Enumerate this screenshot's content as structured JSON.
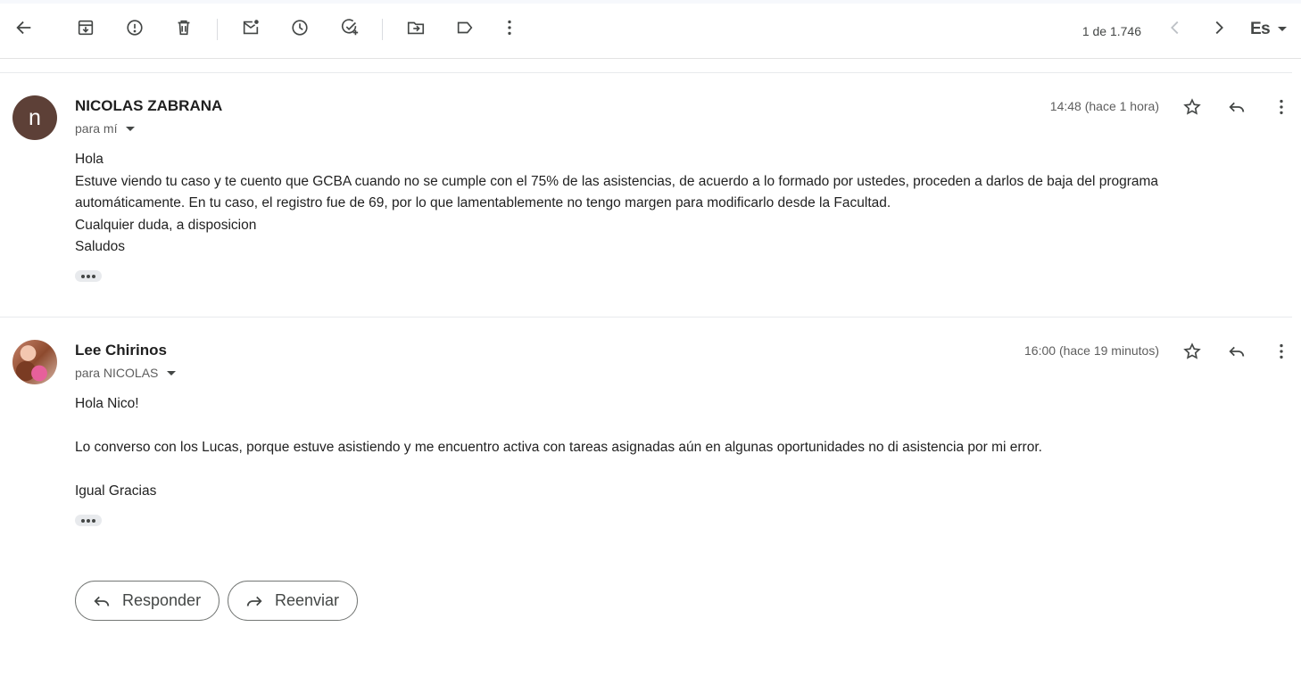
{
  "toolbar": {
    "icons": [
      "back-arrow-icon",
      "archive-icon",
      "report-spam-icon",
      "delete-icon",
      "mark-unread-icon",
      "snooze-icon",
      "add-task-icon",
      "move-to-icon",
      "label-icon",
      "more-vert-icon"
    ],
    "pager": "1 de 1.746",
    "input_tool": "Es"
  },
  "messages": [
    {
      "avatar_letter": "n",
      "avatar_color": "#5d4037",
      "sender": "NICOLAS ZABRANA",
      "recipient": "para mí",
      "time": "14:48 (hace 1 hora)",
      "body": [
        "Hola",
        "Estuve viendo tu caso y te cuento que GCBA cuando no se cumple con el 75% de las asistencias, de acuerdo a lo formado por ustedes, proceden a darlos de baja del programa automáticamente. En tu caso, el registro fue de 69, por lo que lamentablemente no tengo margen para modificarlo desde la Facultad.",
        "Cualquier duda, a disposicion",
        "Saludos"
      ]
    },
    {
      "avatar_letter": "",
      "avatar_color": "",
      "sender": "Lee Chirinos",
      "recipient": "para NICOLAS",
      "time": "16:00 (hace 19 minutos)",
      "body": [
        "Hola Nico!",
        "",
        "Lo converso con los Lucas, porque estuve asistiendo  y me encuentro activa con tareas asignadas aún en algunas oportunidades no di asistencia por mi error.",
        "",
        "Igual Gracias"
      ]
    }
  ],
  "actions": {
    "reply_label": "Responder",
    "forward_label": "Reenviar"
  },
  "colors": {
    "text_primary": "#1f1f1f",
    "text_secondary": "#5e5e5e",
    "icon": "#444746",
    "border": "#747775"
  }
}
